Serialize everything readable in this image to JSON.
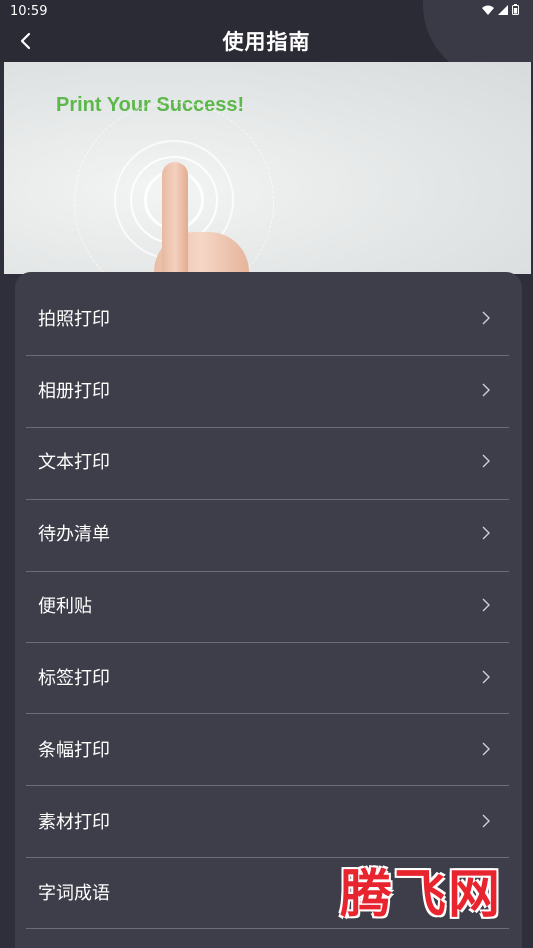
{
  "status_bar": {
    "time": "10:59"
  },
  "header": {
    "title": "使用指南"
  },
  "banner": {
    "headline": "Print Your Success!"
  },
  "menu": {
    "items": [
      {
        "label": "拍照打印"
      },
      {
        "label": "相册打印"
      },
      {
        "label": "文本打印"
      },
      {
        "label": "待办清单"
      },
      {
        "label": "便利贴"
      },
      {
        "label": "标签打印"
      },
      {
        "label": "条幅打印"
      },
      {
        "label": "素材打印"
      },
      {
        "label": "字词成语"
      }
    ]
  },
  "watermark": {
    "text": "腾飞网"
  },
  "colors": {
    "background": "#2f2f3b",
    "card": "#3e3e4a",
    "accent_green": "#5cb84a",
    "watermark_red": "#e8242f"
  }
}
